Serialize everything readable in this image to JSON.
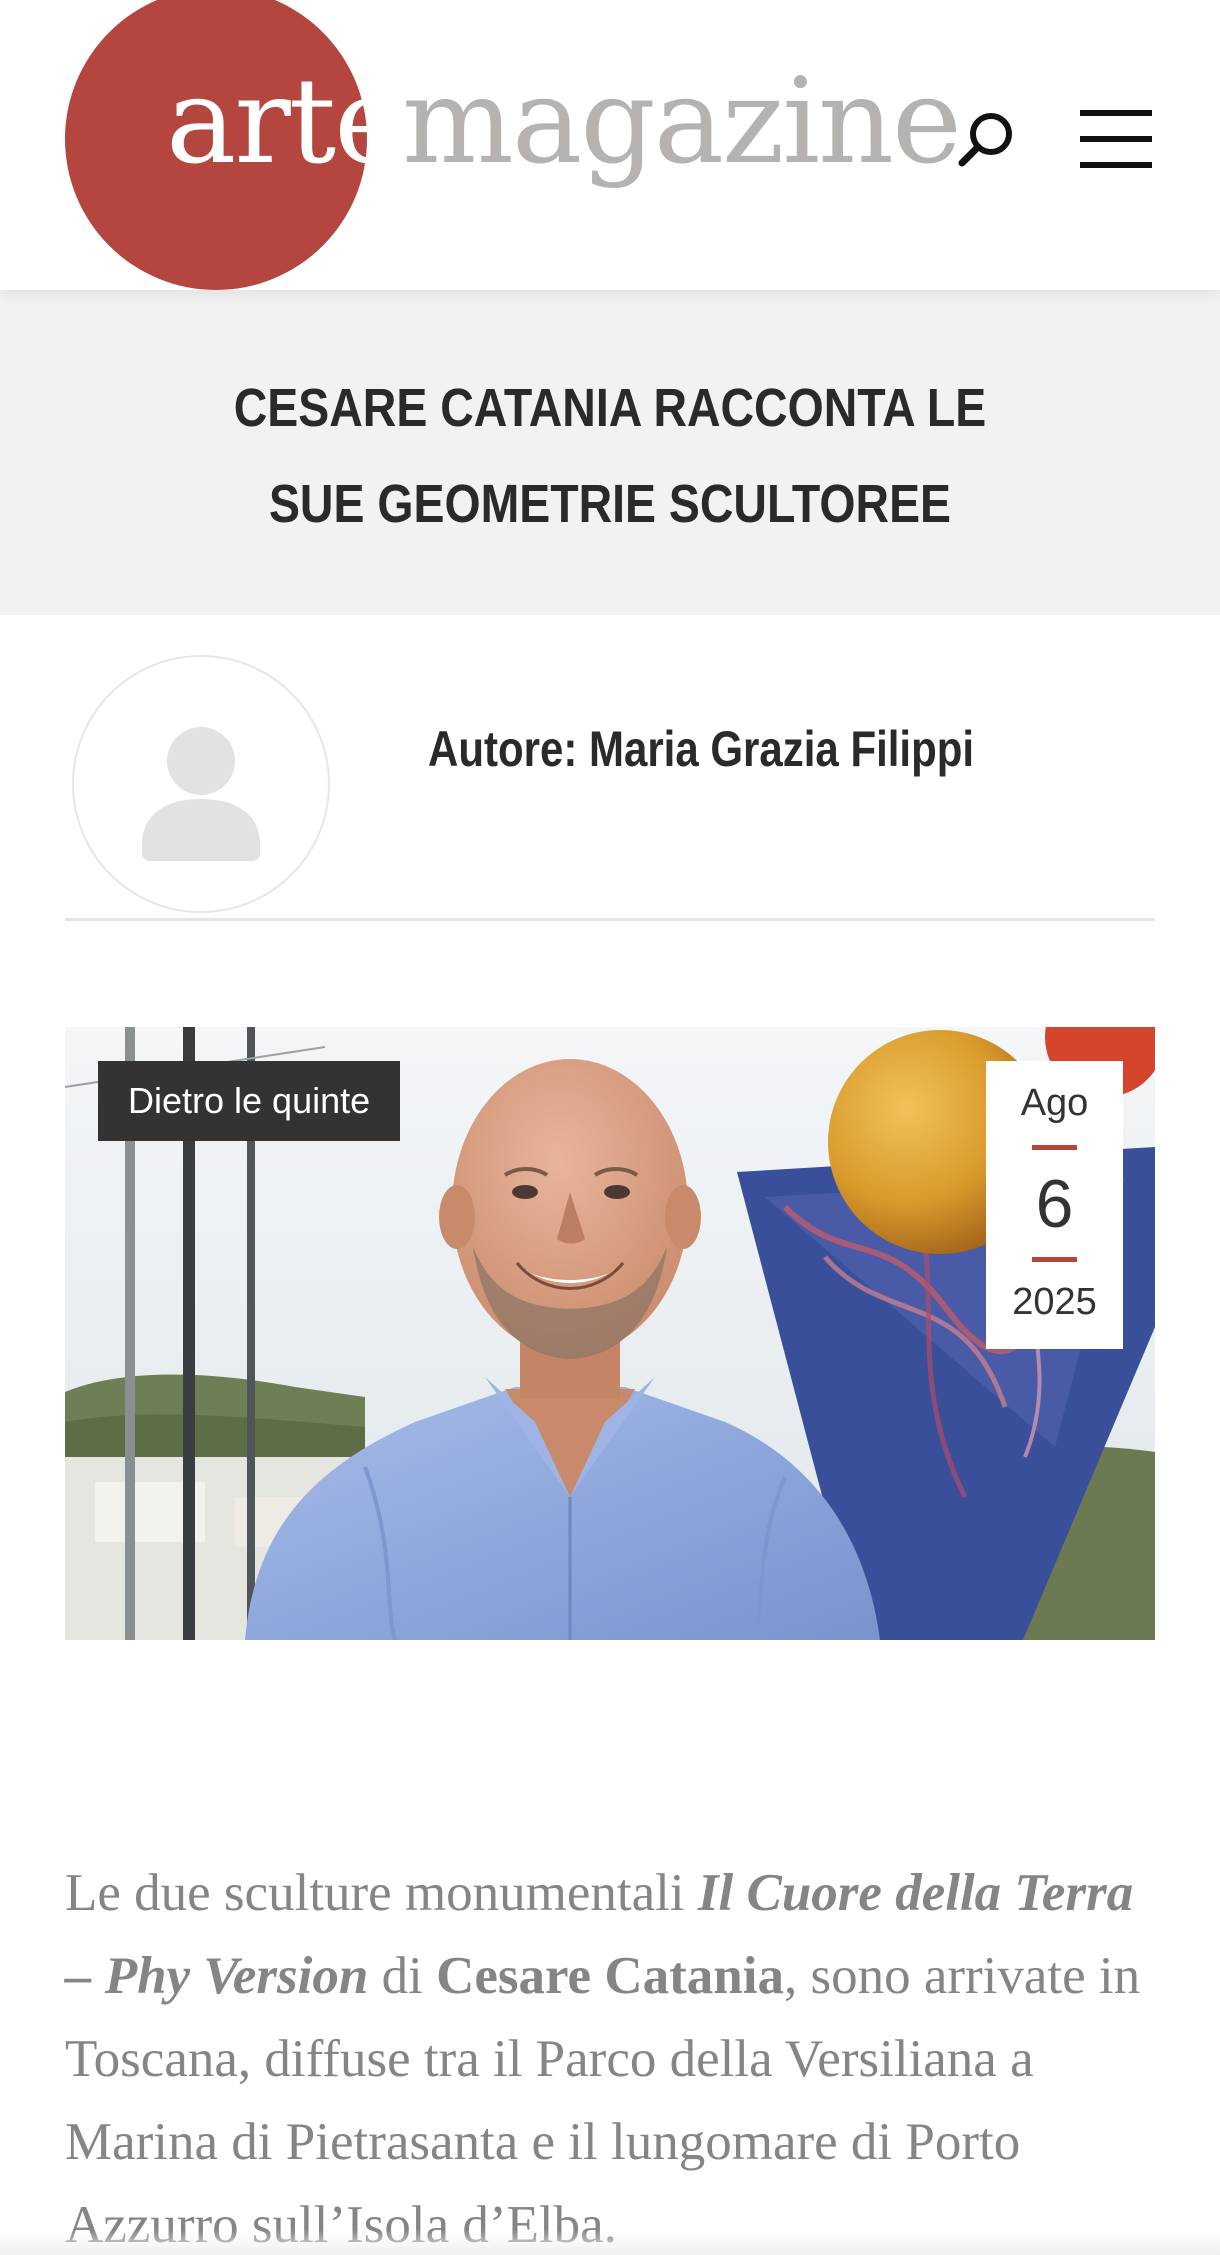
{
  "header": {
    "logo_part1": "arte",
    "logo_part2": "magazine",
    "search_icon": "search-icon",
    "menu_icon": "hamburger-menu-icon"
  },
  "article": {
    "title": "CESARE CATANIA RACCONTA LE SUE GEOMETRIE SCULTOREE",
    "author_line": "Autore: Maria Grazia Filippi",
    "category": "Dietro le quinte",
    "date": {
      "month": "Ago",
      "day": "6",
      "year": "2025"
    },
    "body": {
      "t1": "Le due sculture monumentali ",
      "t2": "Il Cuore della Terra – Phy Version",
      "t3": " di ",
      "t4": "Cesare Catania",
      "t5": ", sono arrivate in Toscana, diffuse tra il Parco della Versiliana a Marina di Pietrasanta e il lungomare di Porto Azzurro sull’Isola d’Elba."
    }
  },
  "colors": {
    "brand_red": "#b5453f",
    "logo_grey": "#b5b2b0",
    "title_band": "#f2f2f2",
    "title_text": "#2a2a2a",
    "body_text": "#858585",
    "tag_bg": "#333333",
    "date_rule": "#b5453f"
  }
}
